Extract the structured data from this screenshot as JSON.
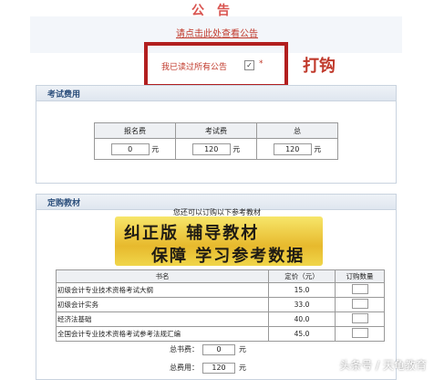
{
  "notice": {
    "title": "公告",
    "link_text": "请点击此处查看公告",
    "confirm_label": "我已读过所有公告",
    "checkbox_checked": true,
    "required_mark": "*"
  },
  "annotation": "打钩",
  "fee_section": {
    "title": "考试费用",
    "headers": [
      "报名费",
      "考试费",
      "总"
    ],
    "values": [
      "0",
      "120",
      "120"
    ],
    "unit": "元"
  },
  "book_section": {
    "title": "定购教材",
    "note": "您还可以订购以下参考教材",
    "banner_line1": "纠正版  辅导教材",
    "banner_line2": "保障  学习参考数据",
    "headers": [
      "书名",
      "定价（元）",
      "订购数量"
    ],
    "rows": [
      {
        "name": "初级会计专业技术资格考试大纲",
        "price": "15.0"
      },
      {
        "name": "初级会计实务",
        "price": "33.0"
      },
      {
        "name": "经济法基础",
        "price": "40.0"
      },
      {
        "name": "全国会计专业技术资格考试参考法规汇编",
        "price": "45.0"
      }
    ],
    "total_books_label": "总书费：",
    "total_books_value": "0",
    "total_fee_label": "总费用：",
    "total_fee_value": "120",
    "unit": "元"
  },
  "watermark": "头条号 / 天龟教育"
}
